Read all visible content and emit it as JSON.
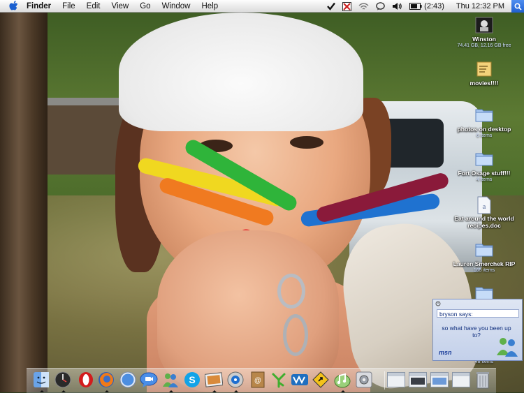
{
  "menubar": {
    "app_name": "Finder",
    "items": [
      "File",
      "Edit",
      "View",
      "Go",
      "Window",
      "Help"
    ],
    "battery_text": "(2:43)",
    "clock": "Thu 12:32 PM"
  },
  "desktop": {
    "icons": [
      {
        "label": "Winston",
        "sub": "74.41 GB, 12.16 GB free",
        "icon": "hard-drive-icon"
      },
      {
        "label": "movies!!!!",
        "sub": "",
        "icon": "notes-icon"
      },
      {
        "label": "photos on desktop",
        "sub": "6 items",
        "icon": "folder-icon"
      },
      {
        "label": "Fort Osage stuff!!!",
        "sub": "4 items",
        "icon": "folder-icon"
      },
      {
        "label": "Eat around the world recipes.doc",
        "sub": "",
        "icon": "document-icon"
      },
      {
        "label": "Lauren Smerchek RIP",
        "sub": "165 items",
        "icon": "folder-icon"
      },
      {
        "label": "",
        "sub": "",
        "icon": "folder-icon"
      },
      {
        "label": "",
        "sub": "48 items",
        "icon": "folder-icon"
      }
    ]
  },
  "msn_popup": {
    "from": "bryson says:",
    "message": "so what have you been up to?",
    "logo": "msn"
  },
  "dock": {
    "apps": [
      "finder-icon",
      "dashboard-icon",
      "opera-icon",
      "firefox-icon",
      "safari-icon",
      "ichat-icon",
      "msn-messenger-icon",
      "skype-icon",
      "iphoto-icon",
      "itunes-icon",
      "address-book-icon",
      "tree-icon",
      "wire-icon",
      "warning-sign-icon",
      "garageband-icon",
      "system-preferences-icon"
    ],
    "minimized": [
      "window-thumbnail-1",
      "window-thumbnail-2",
      "window-thumbnail-3",
      "window-thumbnail-4"
    ],
    "trash": "trash-icon"
  },
  "colors": {
    "menubar": "#ececec",
    "msn_text": "#0b2a7a",
    "accent": "#1f5fd0"
  }
}
